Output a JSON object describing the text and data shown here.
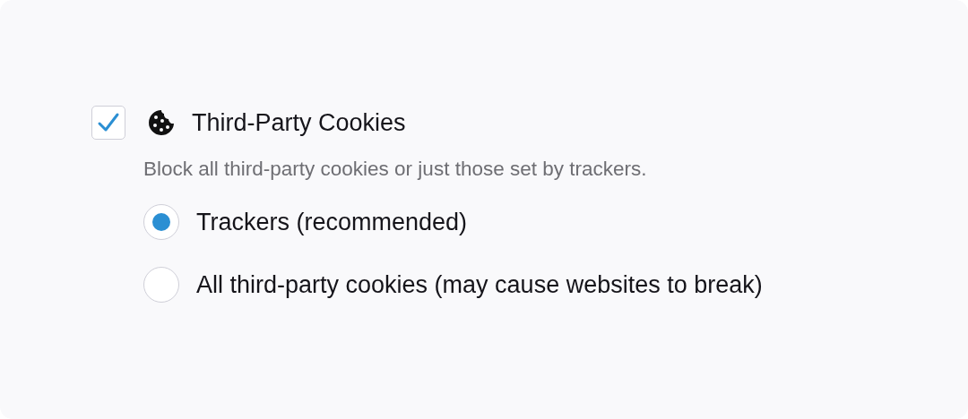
{
  "setting": {
    "title": "Third-Party Cookies",
    "checked": true,
    "description": "Block all third-party cookies or just those set by trackers.",
    "options": [
      {
        "label": "Trackers (recommended)",
        "selected": true
      },
      {
        "label": "All third-party cookies (may cause websites to break)",
        "selected": false
      }
    ]
  }
}
